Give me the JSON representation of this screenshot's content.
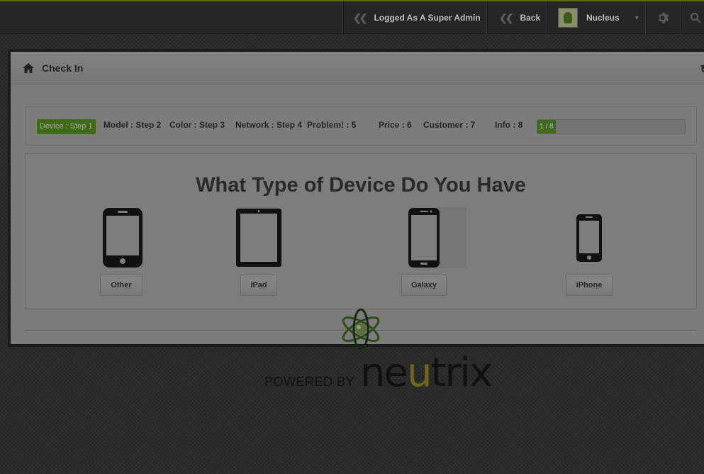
{
  "navbar": {
    "admin_label": "Logged As A Super Admin",
    "back_label": "Back",
    "user_name": "Nucleus"
  },
  "panel": {
    "title": "Check In"
  },
  "wizard": {
    "steps": [
      {
        "label": "Device : Step 1",
        "active": true
      },
      {
        "label": "Model : Step 2"
      },
      {
        "label": "Color : Step 3"
      },
      {
        "label": "Network : Step 4"
      },
      {
        "label": "Problem! : 5"
      },
      {
        "label": "Price : 6"
      },
      {
        "label": "Customer : 7"
      },
      {
        "label": "Info : 8"
      }
    ],
    "progress_label": "1 / 8",
    "progress_fraction": 0.125
  },
  "device_select": {
    "heading": "What Type of Device Do You Have",
    "devices": [
      {
        "label": "Other",
        "icon": "phone-icon"
      },
      {
        "label": "iPad",
        "icon": "tablet-icon"
      },
      {
        "label": "Galaxy",
        "icon": "android-phone-icon",
        "highlighted": true
      },
      {
        "label": "iPhone",
        "icon": "iphone-icon"
      }
    ]
  },
  "footer": {
    "powered_by": "POWERED BY",
    "brand_text": "neutrix",
    "brand_parts": [
      "ne",
      "u",
      "trix"
    ],
    "accent_color": "#6d6a1a"
  },
  "colors": {
    "accent": "#3f6a18",
    "navbar_bg": "#262626"
  }
}
